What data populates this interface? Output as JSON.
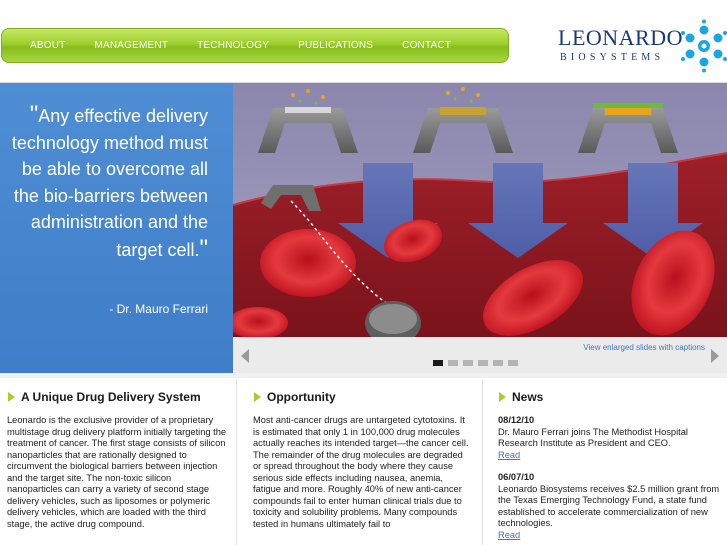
{
  "nav": {
    "items": [
      "ABOUT",
      "MANAGEMENT",
      "TECHNOLOGY",
      "PUBLICATIONS",
      "CONTACT"
    ]
  },
  "logo": {
    "line1": "LEONARDO",
    "line2": "BIOSYSTEMS",
    "icon": "molecule-logo-icon"
  },
  "hero": {
    "quote_open": "\"",
    "quote_text": "Any effective delivery technology method must be able to overcome all the bio-barriers between administration and the target cell.",
    "quote_close": "\"",
    "attribution": "- Dr. Mauro Ferrari",
    "view_link": "View enlarged slides with captions",
    "slide_count": 6,
    "active_slide": 1
  },
  "columns": {
    "unique": {
      "title": "A Unique Drug Delivery System",
      "body": "Leonardo is the exclusive provider of a proprietary multistage drug delivery platform initially targeting the treatment of cancer. The first stage consists of silicon nanoparticles that are rationally designed to circumvent the biological barriers between injection and the target site. The non-toxic silicon nanoparticles can carry a variety of second stage delivery vehicles, such as liposomes or polymeric delivery vehicles, which are loaded with the third stage, the active drug compound."
    },
    "opportunity": {
      "title": "Opportunity",
      "body": "Most anti-cancer drugs are untargeted cytotoxins. It is estimated that only 1 in 100,000 drug molecules actually reaches its intended target—the cancer cell. The remainder of the drug molecules are degraded or spread throughout the body where they cause serious side effects including nausea, anemia, fatigue and more. Roughly 40% of new anti-cancer compounds fail to enter human clinical trials due to toxicity and solubility problems. Many compounds tested in humans ultimately fail to"
    },
    "news": {
      "title": "News",
      "items": [
        {
          "date": "08/12/10",
          "text": "Dr. Mauro Ferrari joins The Methodist Hospital Research Institute as President and CEO.",
          "link": "Read"
        },
        {
          "date": "06/07/10",
          "text": "Leonardo Biosystems receives $2.5 million grant from the Texas Emerging Technology Fund, a state fund established to accelerate commercialization of new technologies.",
          "link": "Read"
        }
      ]
    }
  },
  "colors": {
    "nav_green": "#9ccf2c",
    "quote_blue": "#4486cf",
    "link_blue": "#3d76c2",
    "logo_navy": "#173a7a",
    "logo_cyan": "#1aa7e0"
  }
}
